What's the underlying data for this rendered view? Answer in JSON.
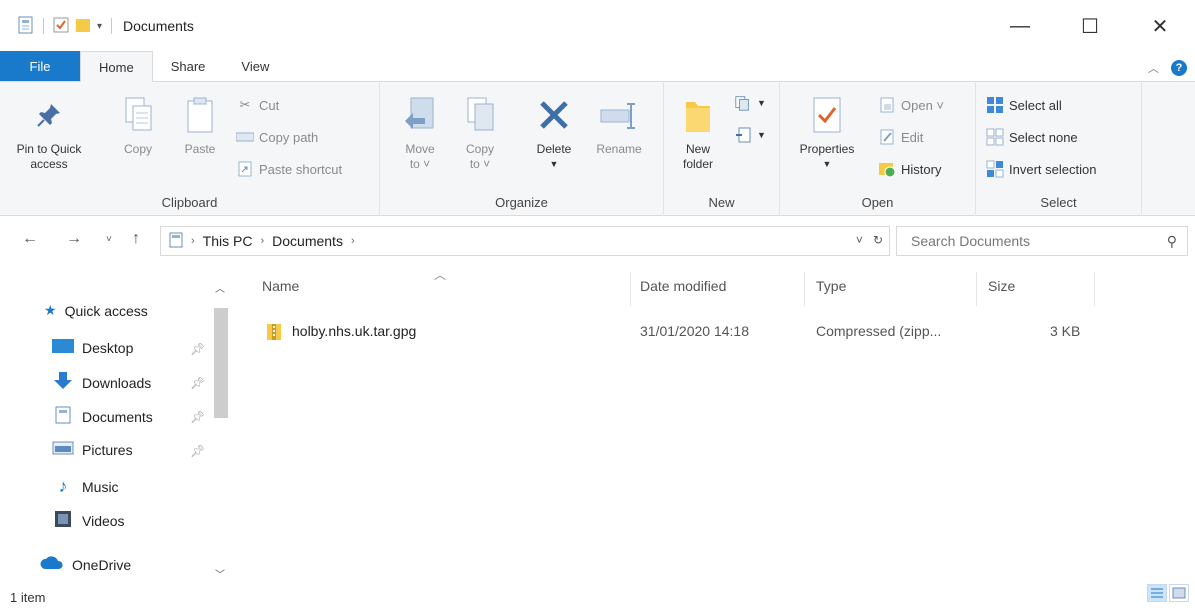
{
  "window": {
    "title": "Documents",
    "controls": {
      "minimize": "—",
      "maximize": "☐",
      "close": "✕"
    }
  },
  "ribbon_tabs": [
    {
      "label": "File"
    },
    {
      "label": "Home"
    },
    {
      "label": "Share"
    },
    {
      "label": "View"
    }
  ],
  "ribbon": {
    "clipboard": {
      "pin_label_1": "Pin to Quick",
      "pin_label_2": "access",
      "copy": "Copy",
      "paste": "Paste",
      "cut": "Cut",
      "copy_path": "Copy path",
      "paste_shortcut": "Paste shortcut",
      "group": "Clipboard"
    },
    "organize": {
      "move_to_1": "Move",
      "move_to_2": "to ˅",
      "copy_to_1": "Copy",
      "copy_to_2": "to ˅",
      "delete": "Delete",
      "rename": "Rename",
      "group": "Organize"
    },
    "new": {
      "new_folder_1": "New",
      "new_folder_2": "folder",
      "group": "New"
    },
    "open": {
      "properties": "Properties",
      "open": "Open ˅",
      "edit": "Edit",
      "history": "History",
      "group": "Open"
    },
    "select": {
      "select_all": "Select all",
      "select_none": "Select none",
      "invert": "Invert selection",
      "group": "Select"
    }
  },
  "address": {
    "crumbs": [
      "This PC",
      "Documents"
    ],
    "search_placeholder": "Search Documents"
  },
  "nav": {
    "quick_access": "Quick access",
    "items": [
      "Desktop",
      "Downloads",
      "Documents",
      "Pictures",
      "Music",
      "Videos"
    ],
    "onedrive": "OneDrive"
  },
  "columns": {
    "name": "Name",
    "date": "Date modified",
    "type": "Type",
    "size": "Size"
  },
  "files": [
    {
      "name": "holby.nhs.uk.tar.gpg",
      "date": "31/01/2020 14:18",
      "type": "Compressed (zipp...",
      "size": "3 KB"
    }
  ],
  "status": {
    "count": "1 item"
  },
  "colors": {
    "accent": "#1979ca",
    "folder": "#f7c948"
  }
}
